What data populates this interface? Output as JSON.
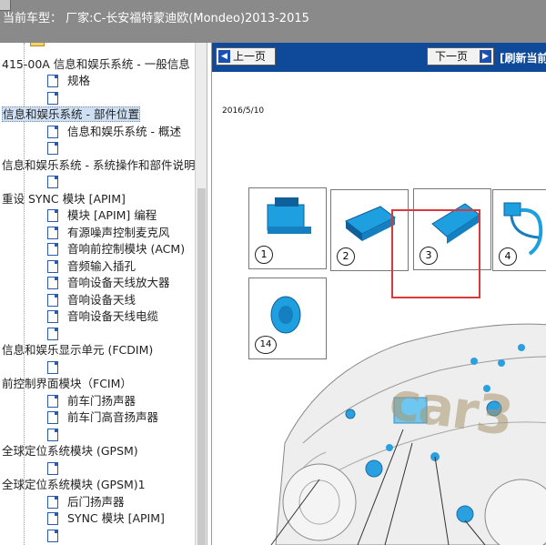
{
  "header": {
    "text": "当前车型：  厂家:C-长安福特蒙迪欧(Mondeo)2013-2015"
  },
  "tree": {
    "rows": [
      {
        "label": "",
        "kind": "folder"
      },
      {
        "label": "415-00A 信息和娱乐系统 - 一般信息",
        "kind": "text"
      },
      {
        "label": "规格",
        "kind": "doc"
      },
      {
        "label": "",
        "kind": "doc"
      },
      {
        "label": "信息和娱乐系统 - 部件位置",
        "kind": "text",
        "selected": true
      },
      {
        "label": "信息和娱乐系统 - 概述",
        "kind": "doc"
      },
      {
        "label": "",
        "kind": "doc"
      },
      {
        "label": "信息和娱乐系统 - 系统操作和部件说明",
        "kind": "text"
      },
      {
        "label": "",
        "kind": "doc"
      },
      {
        "label": "重设 SYNC 模块 [APIM]",
        "kind": "text"
      },
      {
        "label": "模块 [APIM] 编程",
        "kind": "doc"
      },
      {
        "label": "有源噪声控制麦克风",
        "kind": "doc"
      },
      {
        "label": "音响前控制模块 (ACM)",
        "kind": "doc"
      },
      {
        "label": "音频输入插孔",
        "kind": "doc"
      },
      {
        "label": "音响设备天线放大器",
        "kind": "doc"
      },
      {
        "label": "音响设备天线",
        "kind": "doc"
      },
      {
        "label": "音响设备天线电缆",
        "kind": "doc"
      },
      {
        "label": "",
        "kind": "doc"
      },
      {
        "label": "信息和娱乐显示单元 (FCDIM)",
        "kind": "text"
      },
      {
        "label": "",
        "kind": "doc"
      },
      {
        "label": "前控制界面模块（FCIM）",
        "kind": "text"
      },
      {
        "label": "前车门扬声器",
        "kind": "doc"
      },
      {
        "label": "前车门高音扬声器",
        "kind": "doc"
      },
      {
        "label": "",
        "kind": "doc"
      },
      {
        "label": "全球定位系统模块 (GPSM)",
        "kind": "text"
      },
      {
        "label": "",
        "kind": "doc"
      },
      {
        "label": "全球定位系统模块 (GPSM)1",
        "kind": "text"
      },
      {
        "label": "后门扬声器",
        "kind": "doc"
      },
      {
        "label": "SYNC 模块 [APIM]",
        "kind": "doc"
      },
      {
        "label": "",
        "kind": "doc"
      }
    ]
  },
  "doc": {
    "prev_label": "上一页",
    "next_label": "下一页",
    "refresh_label": "[刷新当前",
    "date": "2016/5/10",
    "parts": [
      {
        "num": "1"
      },
      {
        "num": "2"
      },
      {
        "num": "3"
      },
      {
        "num": "4"
      },
      {
        "num": "14"
      }
    ],
    "watermark": "car3"
  },
  "colors": {
    "header_bg": "#8a8a8a",
    "toolbar_bg": "#0f4a9a",
    "highlight": "#d8393a",
    "part_blue": "#1d9fe0"
  }
}
